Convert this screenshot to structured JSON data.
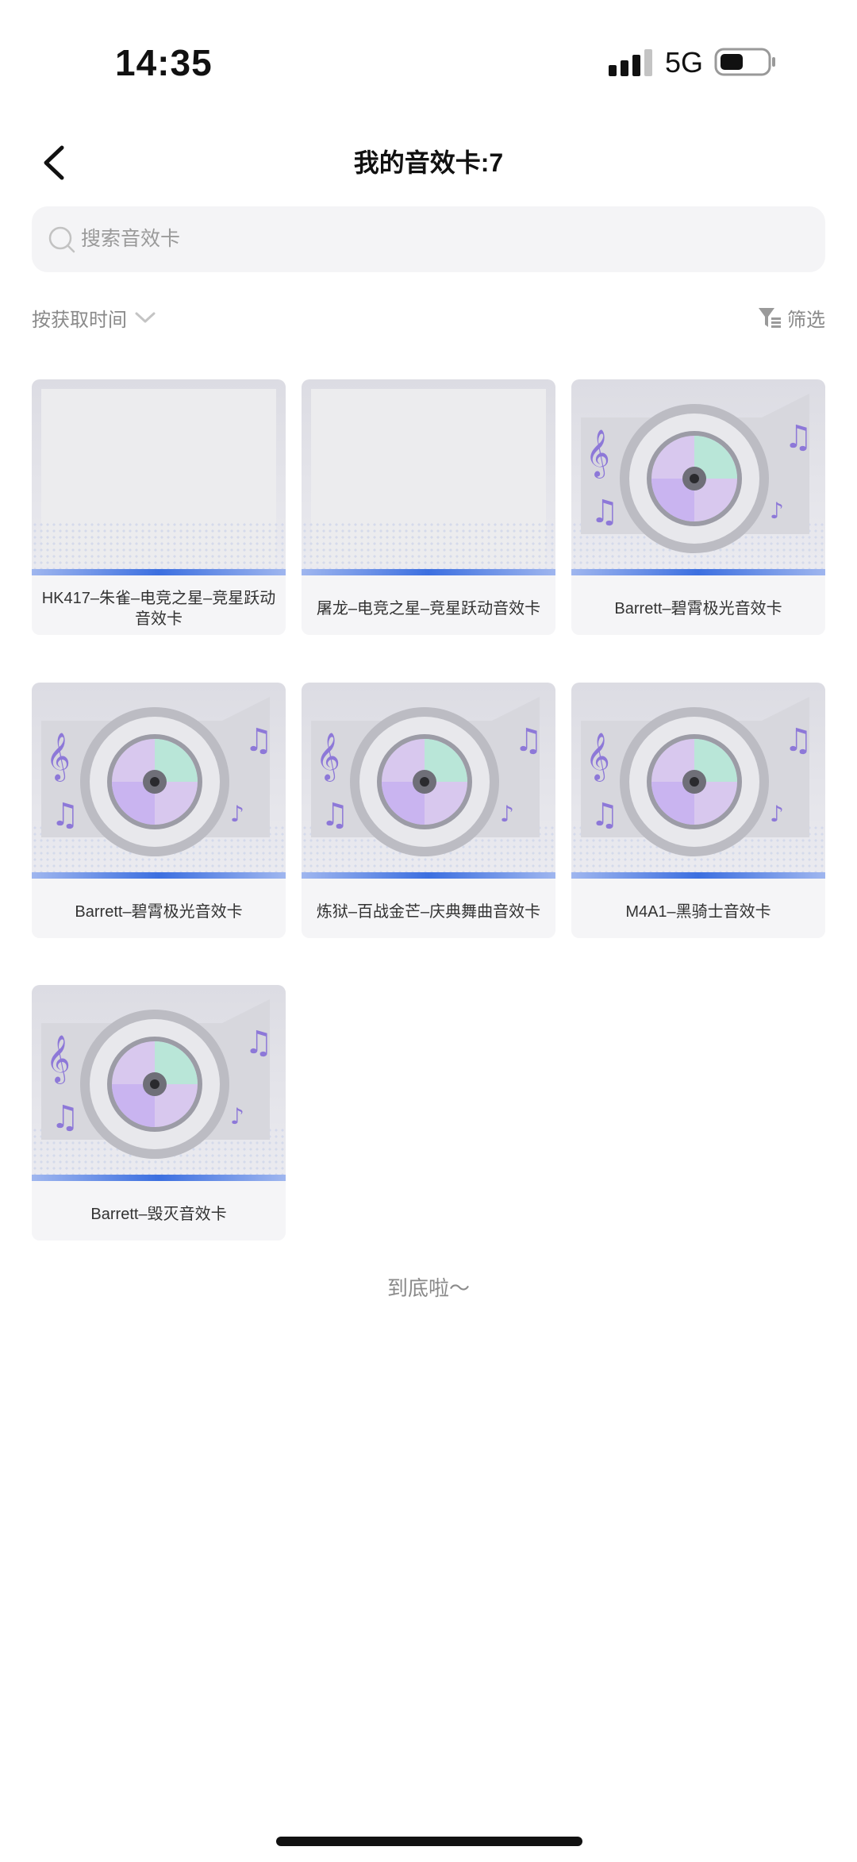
{
  "status_bar": {
    "time": "14:35",
    "network": "5G"
  },
  "header": {
    "title": "我的音效卡:7"
  },
  "search": {
    "placeholder": "搜索音效卡"
  },
  "toolbar": {
    "sort_label": "按获取时间",
    "filter_label": "筛选"
  },
  "cards": [
    {
      "label": "HK417–朱雀–电竞之星–竞星跃动音效卡",
      "image": "blank"
    },
    {
      "label": "屠龙–电竞之星–竞星跃动音效卡",
      "image": "blank"
    },
    {
      "label": "Barrett–碧霄极光音效卡",
      "image": "disc"
    },
    {
      "label": "Barrett–碧霄极光音效卡",
      "image": "disc"
    },
    {
      "label": "炼狱–百战金芒–庆典舞曲音效卡",
      "image": "disc"
    },
    {
      "label": "M4A1–黑骑士音效卡",
      "image": "disc"
    },
    {
      "label": "Barrett–毁灭音效卡",
      "image": "disc"
    }
  ],
  "list_end": "到底啦～",
  "colors": {
    "accent_blue": "#3c6fe0",
    "search_bg": "#f4f4f6",
    "card_bg": "#f5f5f7",
    "secondary_text": "#8a8a8a",
    "note_purple": "#8d78d8"
  }
}
